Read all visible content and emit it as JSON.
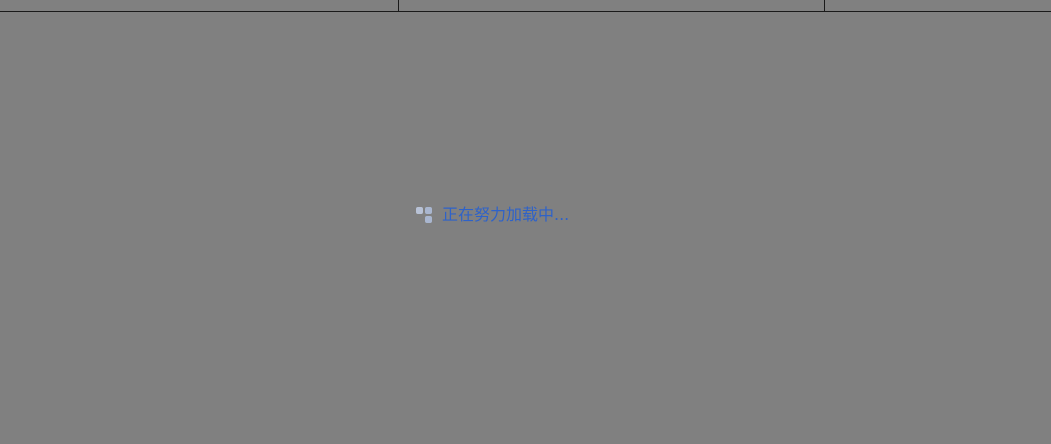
{
  "loading": {
    "icon": "loading-spinner-icon",
    "text": "正在努力加载中...",
    "text_color": "#2e62c9"
  },
  "colors": {
    "overlay_background": "#808080"
  }
}
